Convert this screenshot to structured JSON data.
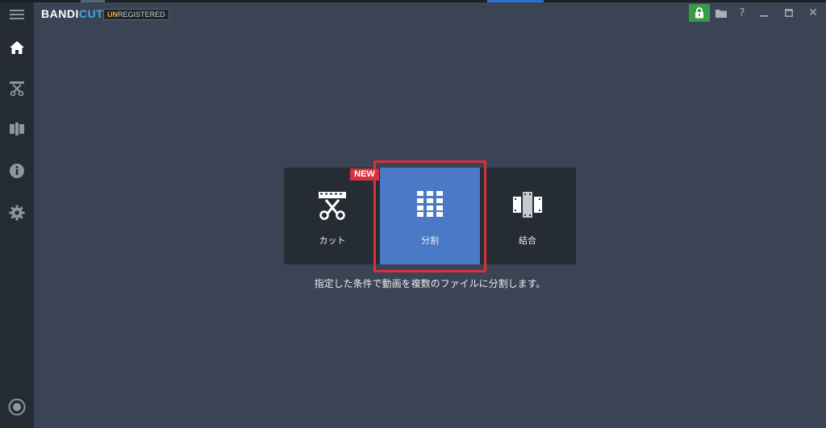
{
  "app": {
    "logo_prefix": "BANDI",
    "logo_suffix": "CUT",
    "badge_prefix": "UN",
    "badge_suffix": "REGISTERED"
  },
  "titlebar": {
    "help": "?",
    "close": "✕"
  },
  "sidebar": {
    "items": [
      {
        "name": "menu",
        "icon": "hamburger-icon"
      },
      {
        "name": "home",
        "icon": "home-icon"
      },
      {
        "name": "cut",
        "icon": "scissors-icon"
      },
      {
        "name": "join",
        "icon": "film-join-icon"
      },
      {
        "name": "info",
        "icon": "info-icon"
      },
      {
        "name": "settings",
        "icon": "gear-icon"
      },
      {
        "name": "record",
        "icon": "record-icon"
      }
    ]
  },
  "modes": {
    "new_badge": "NEW",
    "cut_label": "カット",
    "split_label": "分割",
    "join_label": "結合",
    "selected": "split"
  },
  "description": "指定した条件で動画を複数のファイルに分割します。",
  "colors": {
    "background": "#3b4454",
    "sidebar": "#252b33",
    "panel": "#262c34",
    "selected_tile": "#4a79c6",
    "highlight_border": "#d9313c",
    "lock_button": "#3a9a4a",
    "logo_accent": "#4aa3e8",
    "badge_accent": "#f2a31a"
  }
}
